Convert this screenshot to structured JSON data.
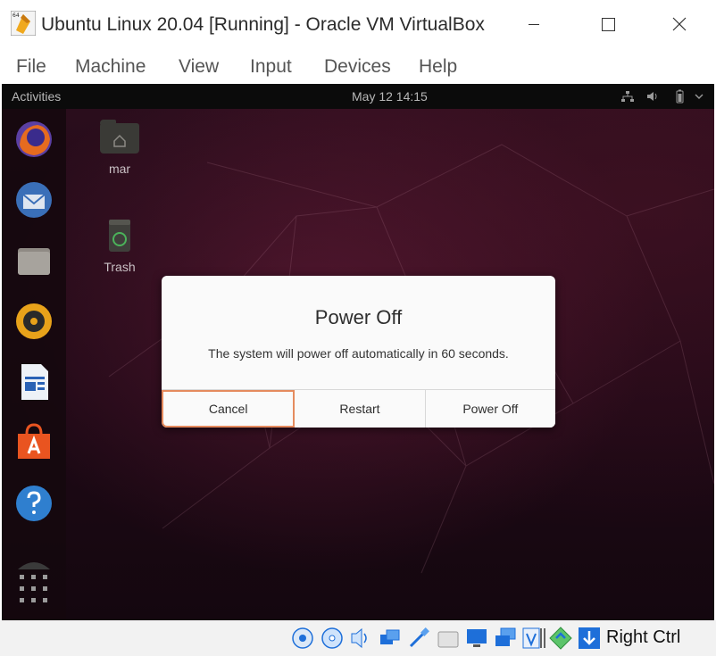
{
  "window": {
    "title": "Ubuntu Linux 20.04 [Running] - Oracle VM VirtualBox",
    "app_badge": "64"
  },
  "menu": {
    "items": [
      "File",
      "Machine",
      "View",
      "Input",
      "Devices",
      "Help"
    ]
  },
  "gnome": {
    "activities": "Activities",
    "clock": "May 12  14:15"
  },
  "desktop": {
    "icons": [
      {
        "label": "mar"
      },
      {
        "label": "Trash"
      }
    ]
  },
  "dialog": {
    "title": "Power Off",
    "message": "The system will power off automatically in 60 seconds.",
    "buttons": {
      "cancel": "Cancel",
      "restart": "Restart",
      "power_off": "Power Off"
    },
    "focus_color": "#e58b5e"
  },
  "statusbar": {
    "host_key": "Right Ctrl"
  },
  "colors": {
    "ubuntu_orange": "#e95420",
    "wallpaper_dark": "#2a0d1c",
    "vbox_blue": "#1e6fd9"
  }
}
